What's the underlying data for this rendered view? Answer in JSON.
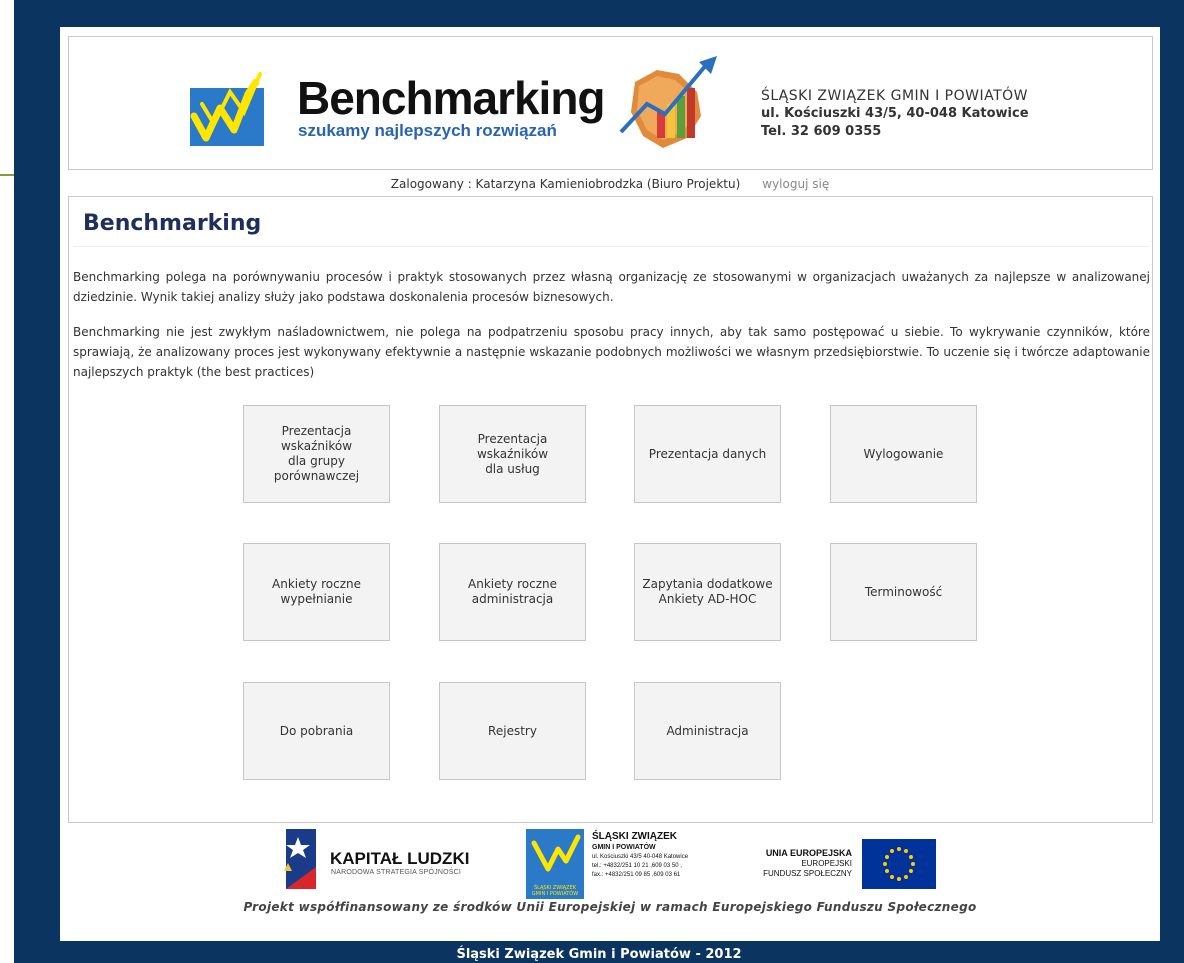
{
  "header": {
    "logo_title": "Benchmarking",
    "logo_subtitle": "szukamy najlepszych rozwiązań",
    "org_name": "ŚLĄSKI ZWIĄZEK GMIN I POWIATÓW",
    "org_address": "ul. Kościuszki 43/5, 40-048 Katowice",
    "org_phone": "Tel. 32 609 0355"
  },
  "login": {
    "status": "Zalogowany : Katarzyna Kamieniobrodzka (Biuro Projektu)",
    "logout_label": "wyloguj się"
  },
  "main": {
    "title": "Benchmarking",
    "paragraph1": "Benchmarking polega na porównywaniu procesów i praktyk stosowanych przez własną organizację ze stosowanymi w organizacjach uważanych za najlepsze w analizowanej dziedzinie. Wynik takiej analizy służy jako podstawa  doskonalenia procesów biznesowych.",
    "paragraph2": "Benchmarking nie jest zwykłym naśladownictwem, nie polega na podpatrzeniu sposobu pracy innych, aby tak samo postępować u siebie. To wykrywanie czynników, które sprawiają, że analizowany proces jest wykonywany efektywnie a następnie wskazanie podobnych możliwości we własnym przedsiębiorstwie. To uczenie się i twórcze adaptowanie najlepszych praktyk (the best practices)",
    "tiles": [
      "Prezentacja\nwskaźników\ndla grupy\nporównawczej",
      "Prezentacja\nwskaźników\ndla usług",
      "Prezentacja danych",
      "Wylogowanie",
      "Ankiety roczne\nwypełnianie",
      "Ankiety roczne\nadministracja",
      "Zapytania dodatkowe\nAnkiety AD-HOC",
      "Terminowość",
      "Do pobrania",
      "Rejestry",
      "Administracja"
    ]
  },
  "footer": {
    "kl_title": "KAPITAŁ LUDZKI",
    "kl_subtitle": "NARODOWA STRATEGIA SPÓJNOŚCI",
    "sz_line1": "ŚLĄSKI ZWIĄZEK",
    "sz_line2": "GMIN I POWIATÓW",
    "sz_line3": "ul. Kościuszki 43/5 40-048 Katowice",
    "sz_line4": "tel.: +4832/251 10 21 ,609 03 50 ,",
    "sz_line5": "fax.: +4832/251 09 85 ,609 03 61",
    "sz_box_text": "ŚLĄSKI ZWIĄZEK GMIN I POWIATÓW",
    "ue_line1": "UNIA EUROPEJSKA",
    "ue_line2": "EUROPEJSKI",
    "ue_line3": "FUNDUSZ SPOŁECZNY",
    "project_note": "Projekt współfinansowany ze środków Unii Europejskiej w ramach Europejskiego Funduszu Społecznego",
    "copyright": "Śląski Związek Gmin i Powiatów - 2012"
  },
  "colors": {
    "frame": "#0c3461",
    "title": "#1e2f5e",
    "logo_blue": "#2b79c9",
    "logo_yellow": "#ffe600",
    "eu_blue": "#003399"
  }
}
